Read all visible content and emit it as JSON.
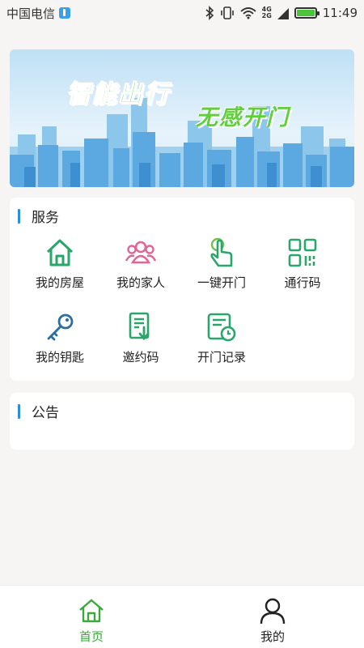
{
  "status_bar": {
    "carrier": "中国电信",
    "net_top": "4G",
    "net_bottom": "2G",
    "time": "11:49",
    "icons": [
      "usb-icon",
      "bluetooth-icon",
      "vibrate-icon",
      "wifi-icon",
      "signal-icon",
      "battery-icon"
    ]
  },
  "banner": {
    "line1": "智能出行",
    "line2": "无感开门"
  },
  "services": {
    "title": "服务",
    "items": [
      {
        "label": "我的房屋",
        "icon": "house-icon",
        "color": "#2aa66a"
      },
      {
        "label": "我的家人",
        "icon": "family-icon",
        "color": "#e0669a"
      },
      {
        "label": "一键开门",
        "icon": "touch-icon",
        "color": "#6cc24a"
      },
      {
        "label": "通行码",
        "icon": "qrcode-icon",
        "color": "#2aa66a"
      },
      {
        "label": "我的钥匙",
        "icon": "key-icon",
        "color": "#2a6fa0"
      },
      {
        "label": "邀约码",
        "icon": "invite-icon",
        "color": "#2aa66a"
      },
      {
        "label": "开门记录",
        "icon": "record-icon",
        "color": "#2aa66a"
      }
    ]
  },
  "notice": {
    "title": "公告"
  },
  "tabbar": {
    "tabs": [
      {
        "label": "首页",
        "icon": "home-icon",
        "active": true
      },
      {
        "label": "我的",
        "icon": "user-icon",
        "active": false
      }
    ],
    "active_color": "#3aa83a",
    "inactive_color": "#222222"
  },
  "colors": {
    "accent_bar": "#2a8ee0",
    "background": "#f6f5f4"
  }
}
